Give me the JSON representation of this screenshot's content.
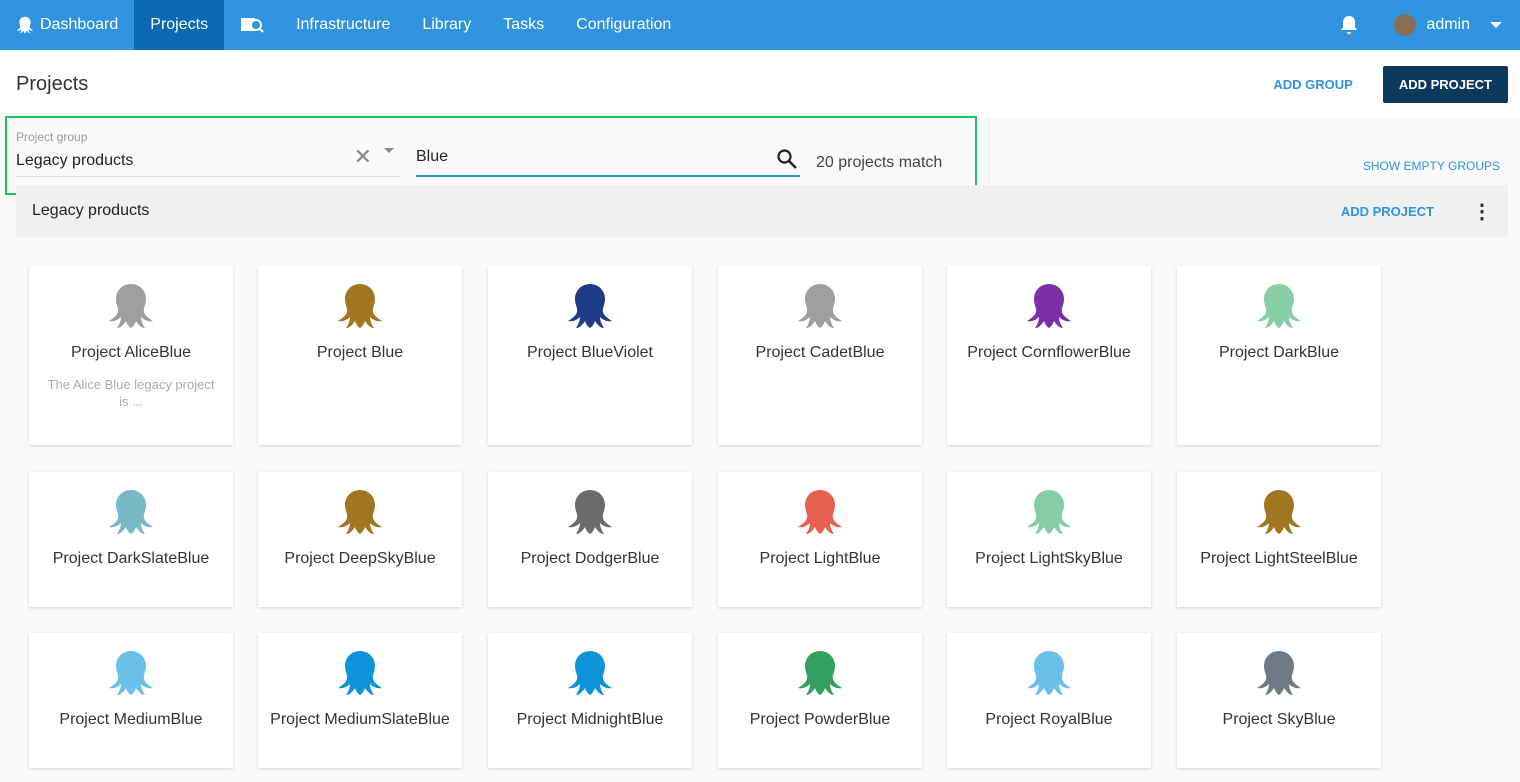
{
  "nav": {
    "items": [
      "Dashboard",
      "Projects",
      "Infrastructure",
      "Library",
      "Tasks",
      "Configuration"
    ],
    "user": "admin"
  },
  "header": {
    "title": "Projects",
    "add_group": "ADD GROUP",
    "add_project": "ADD PROJECT"
  },
  "filter": {
    "group_label": "Project group",
    "group_value": "Legacy products",
    "search_value": "Blue",
    "match_text": "20 projects match",
    "show_empty": "SHOW EMPTY GROUPS"
  },
  "group": {
    "name": "Legacy products",
    "add_project": "ADD PROJECT"
  },
  "projects": [
    {
      "name": "Project AliceBlue",
      "desc": "The Alice Blue legacy project is ...",
      "color": "#9e9e9e"
    },
    {
      "name": "Project Blue",
      "color": "#a0761f"
    },
    {
      "name": "Project BlueViolet",
      "color": "#1f3c88"
    },
    {
      "name": "Project CadetBlue",
      "color": "#9e9e9e"
    },
    {
      "name": "Project CornflowerBlue",
      "color": "#7b2fa8"
    },
    {
      "name": "Project DarkBlue",
      "color": "#87cea7"
    },
    {
      "name": "Project DarkSlateBlue",
      "color": "#79b8c5"
    },
    {
      "name": "Project DeepSkyBlue",
      "color": "#a0761f"
    },
    {
      "name": "Project DodgerBlue",
      "color": "#6b6b6b"
    },
    {
      "name": "Project LightBlue",
      "color": "#e8604f"
    },
    {
      "name": "Project LightSkyBlue",
      "color": "#87cea7"
    },
    {
      "name": "Project LightSteelBlue",
      "color": "#a0761f"
    },
    {
      "name": "Project MediumBlue",
      "color": "#6ac0e8"
    },
    {
      "name": "Project MediumSlateBlue",
      "color": "#0e93d8"
    },
    {
      "name": "Project MidnightBlue",
      "color": "#0e93d8"
    },
    {
      "name": "Project PowderBlue",
      "color": "#33a060"
    },
    {
      "name": "Project RoyalBlue",
      "color": "#6ac0e8"
    },
    {
      "name": "Project SkyBlue",
      "color": "#6e7a86"
    }
  ]
}
